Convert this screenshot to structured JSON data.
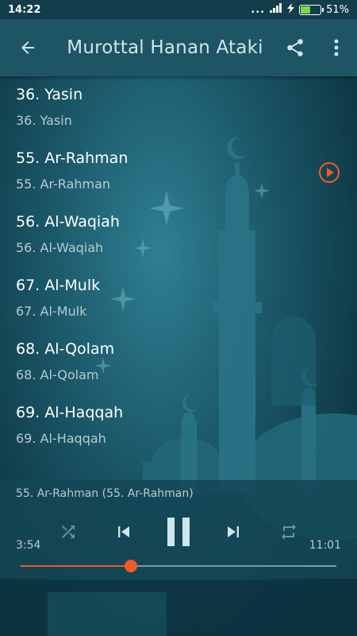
{
  "status_bar": {
    "time": "14:22",
    "signal_dots": "...",
    "battery_percent": "51%",
    "battery_level": 0.51
  },
  "toolbar": {
    "title": "Murottal Hanan Ataki",
    "back_icon": "arrow-left-icon",
    "share_icon": "share-icon",
    "menu_icon": "more-vert-icon"
  },
  "tracks": [
    {
      "title": "36. Yasin",
      "subtitle": "36. Yasin",
      "playing": false
    },
    {
      "title": "55. Ar-Rahman",
      "subtitle": "55. Ar-Rahman",
      "playing": true
    },
    {
      "title": "56. Al-Waqiah",
      "subtitle": "56. Al-Waqiah",
      "playing": false
    },
    {
      "title": "67. Al-Mulk",
      "subtitle": "67. Al-Mulk",
      "playing": false
    },
    {
      "title": "68. Al-Qolam",
      "subtitle": "68. Al-Qolam",
      "playing": false
    },
    {
      "title": "69. Al-Haqqah",
      "subtitle": "69. Al-Haqqah",
      "playing": false
    }
  ],
  "player": {
    "now_playing": "55. Ar-Rahman (55. Ar-Rahman)",
    "current_time": "3:54",
    "total_time": "11:01",
    "progress": 0.35
  },
  "colors": {
    "accent": "#f05a28",
    "toolbar": "#1d5565",
    "background": "#1b5868"
  }
}
